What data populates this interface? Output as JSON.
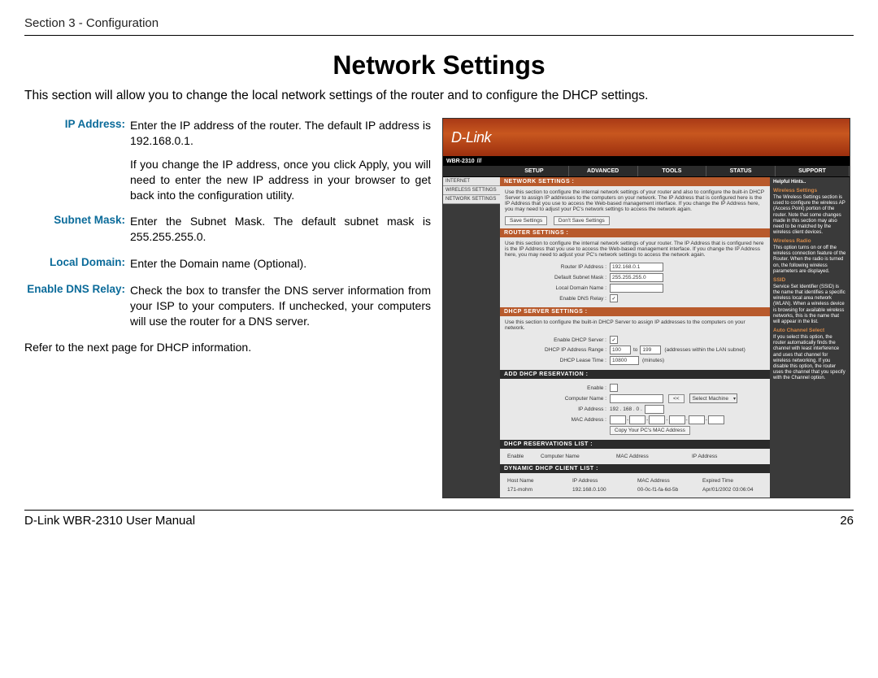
{
  "header": {
    "section": "Section 3 - Configuration"
  },
  "title": "Network Settings",
  "intro": "This section will allow you to change the local network settings of the router and to configure the DHCP settings.",
  "defs": {
    "ip_label": "IP Address:",
    "ip_text1": "Enter the IP address of the router. The default IP address is 192.168.0.1.",
    "ip_text2": "If you change the IP address, once you click Apply, you will need to enter the new IP address in your browser to get back into the configuration utility.",
    "subnet_label": "Subnet Mask:",
    "subnet_text": "Enter the Subnet Mask. The default subnet mask is 255.255.255.0.",
    "domain_label": "Local Domain:",
    "domain_text": "Enter the Domain name (Optional).",
    "dns_label": "Enable DNS Relay:",
    "dns_text": "Check the box to transfer the DNS server information from your ISP to your computers. If unchecked, your computers will use the router for a DNS server."
  },
  "next_note": "Refer to the next page for DHCP information.",
  "shot": {
    "brand": "D-Link",
    "model": "WBR-2310",
    "tabs": [
      "SETUP",
      "ADVANCED",
      "TOOLS",
      "STATUS",
      "SUPPORT"
    ],
    "leftnav": [
      "INTERNET",
      "WIRELESS SETTINGS",
      "NETWORK SETTINGS"
    ],
    "netset_hdr": "NETWORK SETTINGS :",
    "netset_body": "Use this section to configure the internal network settings of your router and also to configure the built-in DHCP Server to assign IP addresses to the computers on your network. The IP Address that is configured here is the IP Address that you use to access the Web-based management interface. If you change the IP Address here, you may need to adjust your PC's network settings to access the network again.",
    "save_btn": "Save Settings",
    "dont_save_btn": "Don't Save Settings",
    "router_hdr": "ROUTER SETTINGS :",
    "router_body": "Use this section to configure the internal network settings of your router. The IP Address that is configured here is the IP Address that you use to access the Web-based management interface. If you change the IP Address here, you may need to adjust your PC's network settings to access the network again.",
    "router_ip_lbl": "Router IP Address :",
    "router_ip_val": "192.168.0.1",
    "subnet_lbl": "Default Subnet Mask :",
    "subnet_val": "255.255.255.0",
    "local_domain_lbl": "Local Domain Name :",
    "dns_relay_lbl": "Enable DNS Relay :",
    "dhcp_hdr": "DHCP SERVER SETTINGS :",
    "dhcp_body": "Use this section to configure the built-in DHCP Server to assign IP addresses to the computers on your network.",
    "dhcp_enable_lbl": "Enable DHCP Server :",
    "dhcp_range_lbl": "DHCP IP Address Range :",
    "dhcp_range_from": "100",
    "dhcp_range_to": "199",
    "dhcp_range_note": "(addresses within the LAN subnet)",
    "dhcp_lease_lbl": "DHCP Lease Time :",
    "dhcp_lease_val": "10800",
    "dhcp_lease_unit": "(minutes)",
    "add_res_hdr": "ADD DHCP RESERVATION :",
    "res_enable_lbl": "Enable :",
    "res_cname_lbl": "Computer Name :",
    "res_select_btn": "<<",
    "res_select_opt": "Select Machine",
    "res_ip_lbl": "IP Address :",
    "res_ip_prefix": "192 . 168 . 0 .",
    "res_mac_lbl": "MAC Address :",
    "res_copy_btn": "Copy Your PC's MAC Address",
    "reslist_hdr": "DHCP RESERVATIONS LIST :",
    "reslist_cols": [
      "Enable",
      "Computer Name",
      "MAC Address",
      "IP Address"
    ],
    "dynlist_hdr": "DYNAMIC DHCP CLIENT LIST :",
    "dynlist_cols": [
      "Host Name",
      "IP Address",
      "MAC Address",
      "Expired Time"
    ],
    "dynlist_row": [
      "171-mohm",
      "192.168.0.100",
      "00-0c-f1-fa-6d-5b",
      "Apr/01/2002 03:06:04"
    ],
    "help_hdr": "Helpful Hints..",
    "help_ws_t": "Wireless Settings",
    "help_ws": "The Wireless Settings section is used to configure the wireless AP (Access Point) portion of the router. Note that some changes made in this section may also need to be matched by the wireless client devices.",
    "help_wr_t": "Wireless Radio",
    "help_wr": "This option turns on or off the wireless connection feature of the Router. When the radio is turned on, the following wireless parameters are displayed.",
    "help_ssid_t": "SSID",
    "help_ssid": "Service Set Identifier (SSID) is the name that identifies a specific wireless local area network (WLAN). When a wireless device is browsing for available wireless networks, this is the name that will appear in the list.",
    "help_acs_t": "Auto Channel Select",
    "help_acs": "If you select this option, the router automatically finds the channel with least interference and uses that channel for wireless networking. If you disable this option, the router uses the channel that you specify with the Channel option."
  },
  "footer": {
    "left": "D-Link WBR-2310 User Manual",
    "right": "26"
  }
}
